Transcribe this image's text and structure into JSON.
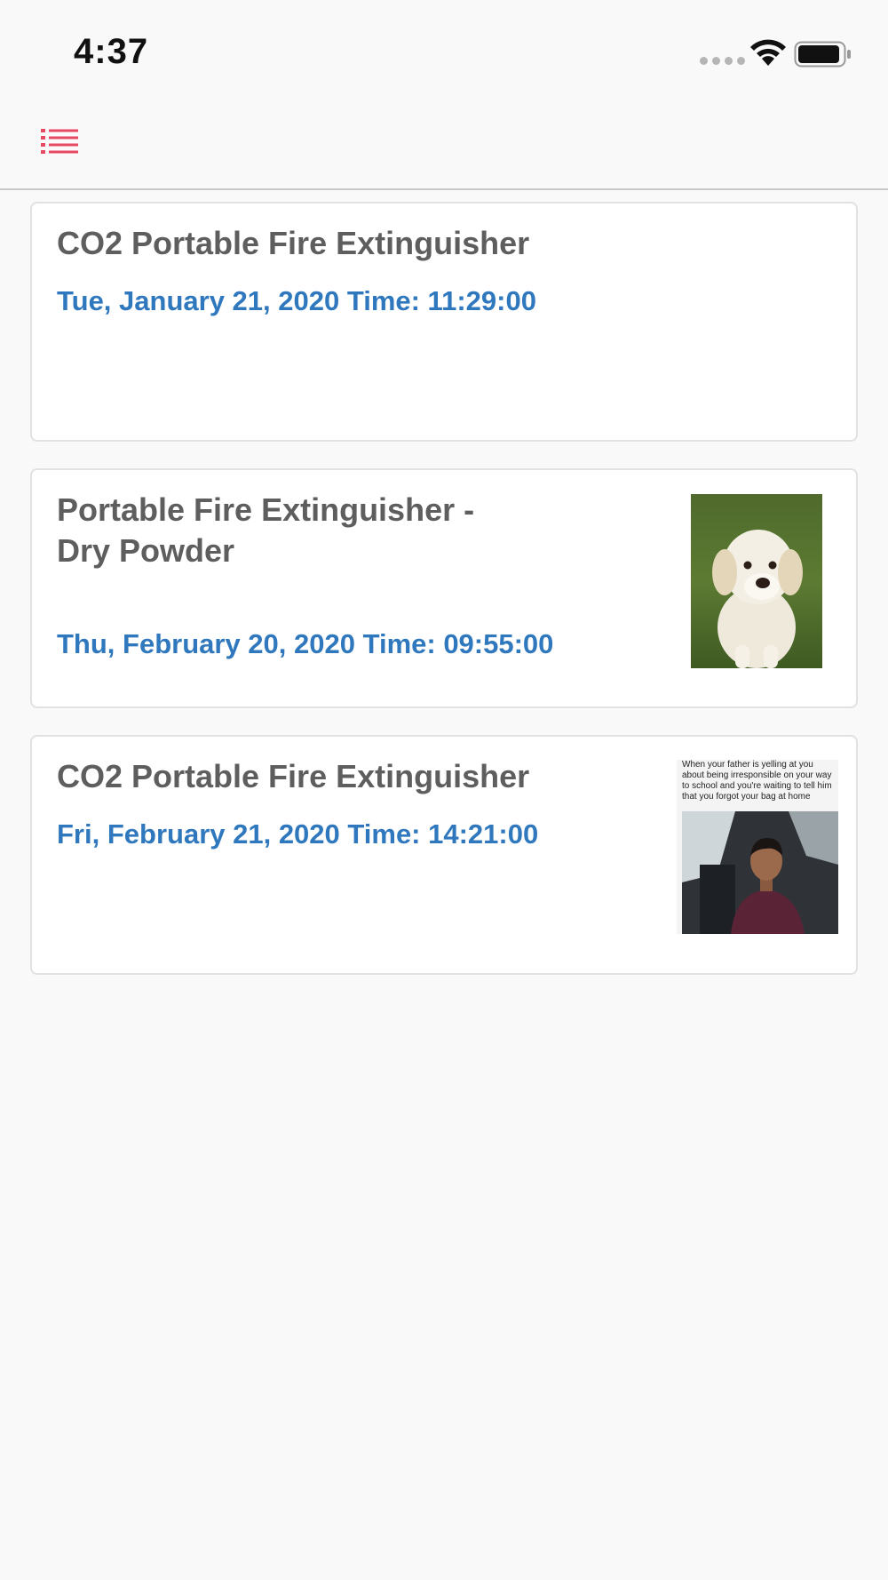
{
  "status_bar": {
    "time": "4:37",
    "icons": [
      "signal-icon",
      "wifi-icon",
      "battery-icon"
    ]
  },
  "nav_bar": {
    "menu_icon": "list-menu-icon",
    "accent_color": "#e64a63"
  },
  "colors": {
    "title": "#5e5e5e",
    "date": "#2f78be",
    "background": "#f9f9f9",
    "card": "#ffffff"
  },
  "records": [
    {
      "title": "CO2 Portable Fire Extinguisher",
      "date": "Tue, January 21, 2020 Time: 11:29:00",
      "image": null
    },
    {
      "title": "Portable Fire Extinguisher - Dry Powder",
      "date": "Thu, February 20, 2020 Time: 09:55:00",
      "image": "puppy-photo"
    },
    {
      "title": "CO2 Portable Fire Extinguisher",
      "date": "Fri, February 21, 2020 Time: 14:21:00",
      "image": "meme-photo",
      "image_caption": "When your father is yelling at you about being irresponsible on your way to school and you're waiting to tell him that you forgot your bag at home"
    }
  ]
}
